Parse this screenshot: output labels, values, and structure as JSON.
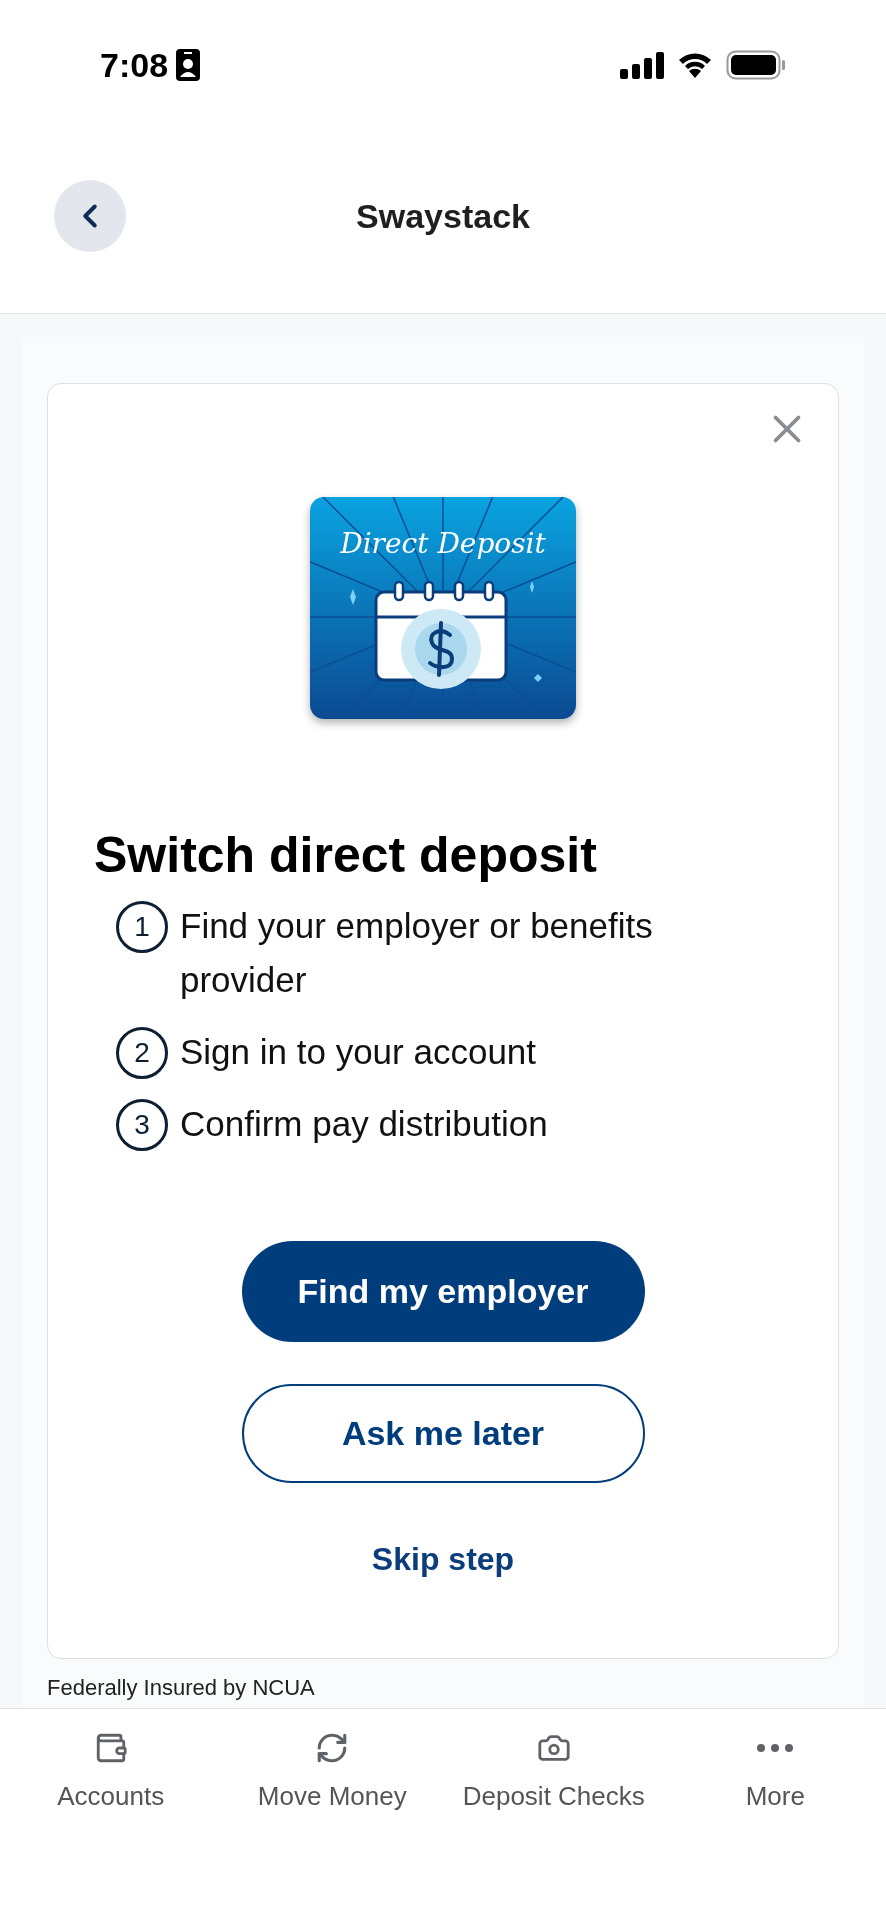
{
  "status_bar": {
    "time": "7:08"
  },
  "header": {
    "title": "Swaystack"
  },
  "card": {
    "illustration": {
      "title": "Direct Deposit"
    },
    "heading": "Switch direct deposit",
    "steps": [
      {
        "number": "1",
        "text": "Find your employer or benefits provider"
      },
      {
        "number": "2",
        "text": "Sign in to your account"
      },
      {
        "number": "3",
        "text": "Confirm pay distribution"
      }
    ],
    "primary_button": "Find my employer",
    "secondary_button": "Ask me later",
    "skip_link": "Skip step"
  },
  "footer_text": "Federally Insured by NCUA",
  "tab_bar": [
    {
      "label": "Accounts"
    },
    {
      "label": "Move Money"
    },
    {
      "label": "Deposit Checks"
    },
    {
      "label": "More"
    }
  ]
}
